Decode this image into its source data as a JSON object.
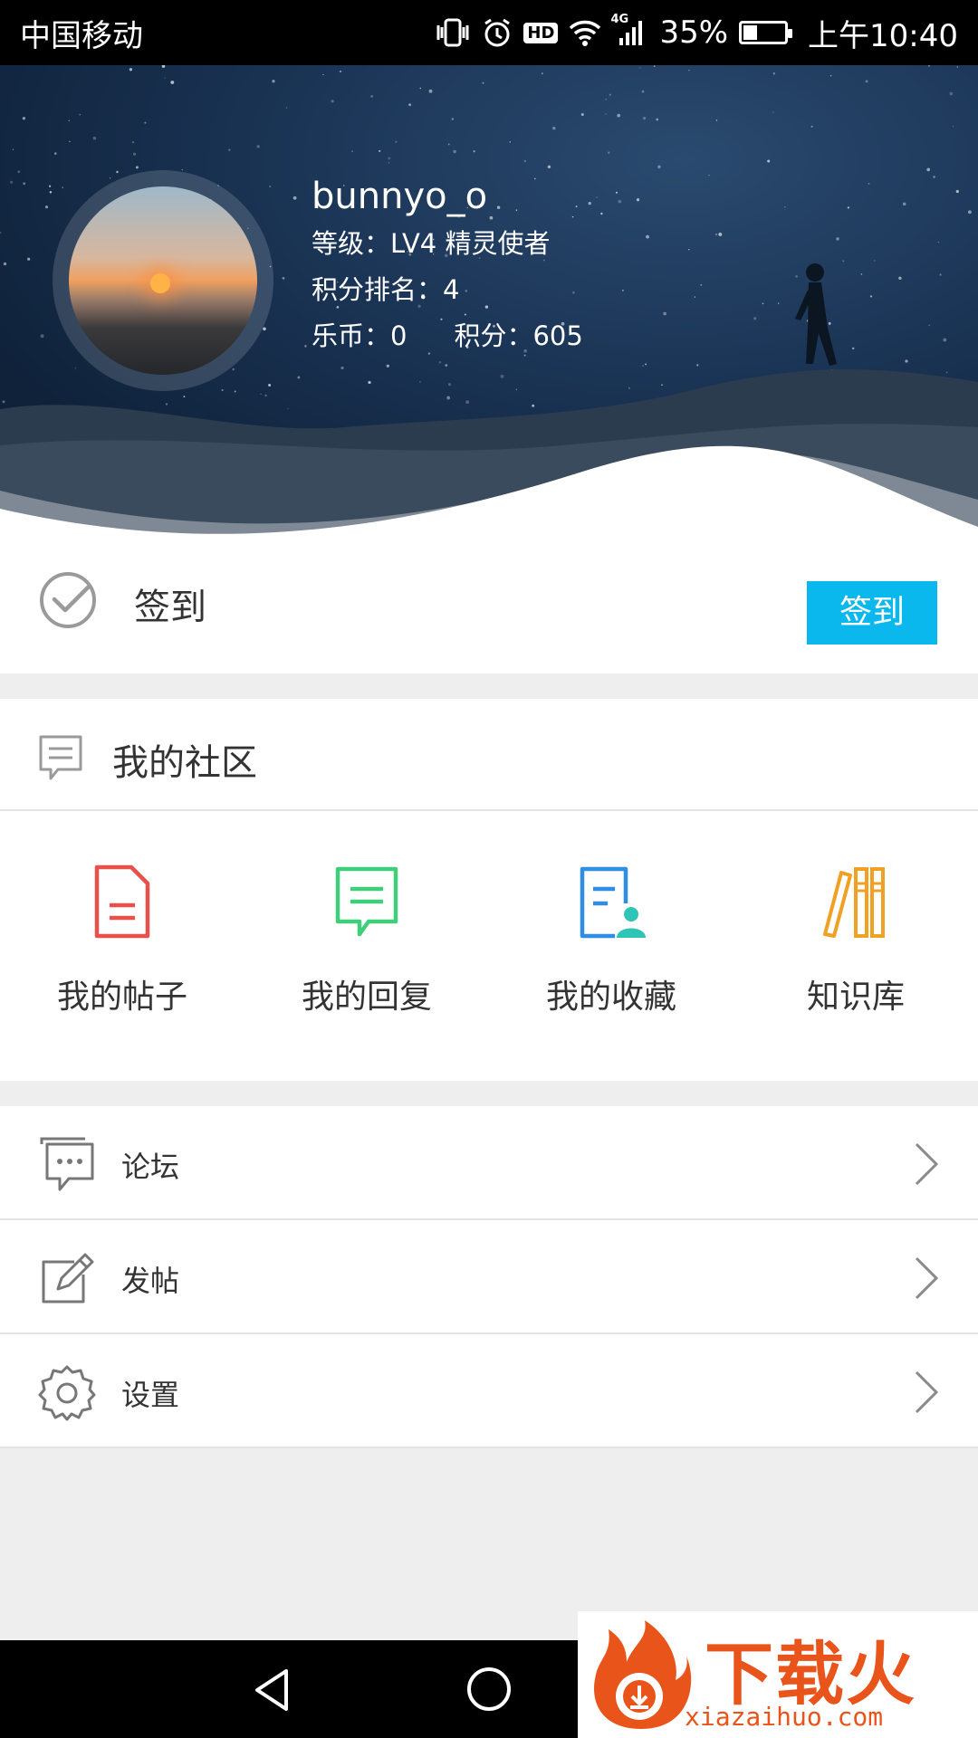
{
  "status_bar": {
    "carrier": "中国移动",
    "hd": "HD",
    "network": "4G",
    "battery": "35%",
    "battery_level": 0.35,
    "time": "上午10:40"
  },
  "profile": {
    "username": "bunnyo_o",
    "level": "等级：LV4 精灵使者",
    "rank": "积分排名：4",
    "coins": "乐币：0",
    "points": "积分：605"
  },
  "signin": {
    "label": "签到",
    "button": "签到",
    "button_color": "#0ab8ee"
  },
  "community": {
    "title": "我的社区",
    "items": [
      {
        "label": "我的帖子",
        "icon": "document-icon",
        "color": "#e8504a"
      },
      {
        "label": "我的回复",
        "icon": "chat-bubble-icon",
        "color": "#3fcf7b"
      },
      {
        "label": "我的收藏",
        "icon": "favorite-user-icon",
        "color": "#2f8de4"
      },
      {
        "label": "知识库",
        "icon": "books-icon",
        "color": "#f0a023"
      }
    ]
  },
  "menu": {
    "items": [
      {
        "label": "论坛",
        "icon": "forum-icon"
      },
      {
        "label": "发帖",
        "icon": "edit-icon"
      },
      {
        "label": "设置",
        "icon": "gear-icon"
      }
    ]
  },
  "watermark": {
    "name": "下载火",
    "url": "xiazaihuo.com"
  }
}
